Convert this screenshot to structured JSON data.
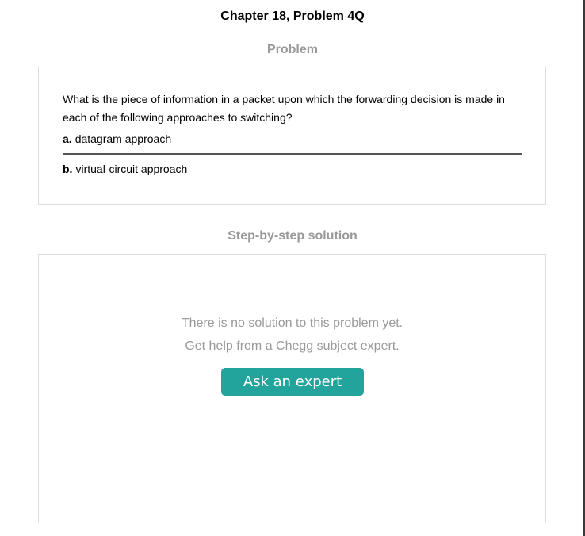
{
  "chapter_title": "Chapter 18, Problem 4Q",
  "problem": {
    "heading": "Problem",
    "question": "What is the piece of information in a packet upon which the forwarding decision is made in each of the following approaches to switching?",
    "options": [
      {
        "letter": "a.",
        "text": "datagram approach"
      },
      {
        "letter": "b.",
        "text": "virtual-circuit approach"
      }
    ]
  },
  "solution": {
    "heading": "Step-by-step solution",
    "empty_message_1": "There is no solution to this problem yet.",
    "empty_message_2": "Get help from a Chegg subject expert.",
    "ask_button_label": "Ask an expert"
  },
  "colors": {
    "button": "#22a39b",
    "muted_text": "#999999",
    "border": "#dcdcdc"
  }
}
